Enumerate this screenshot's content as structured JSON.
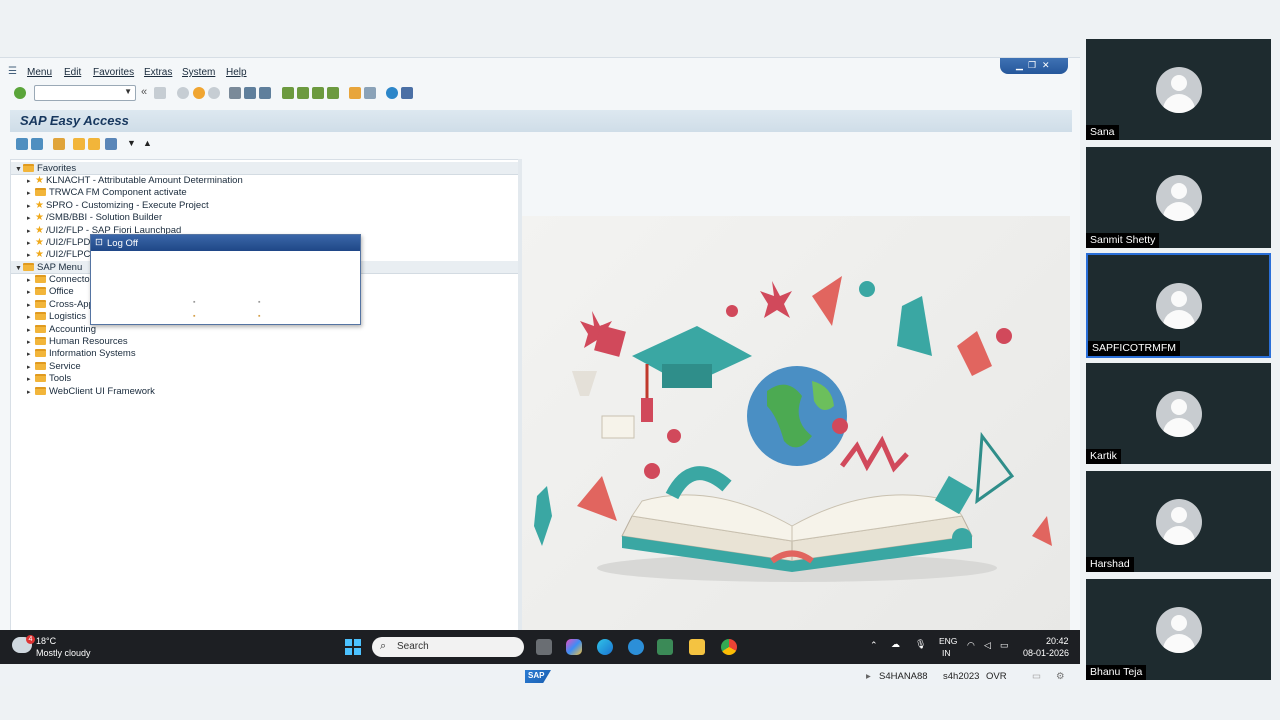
{
  "menu": {
    "items": [
      {
        "label": "Menu"
      },
      {
        "label": "Edit"
      },
      {
        "label": "Favorites"
      },
      {
        "label": "Extras"
      },
      {
        "label": "System"
      },
      {
        "label": "Help"
      }
    ]
  },
  "toolbar": {
    "command_value": "",
    "back_glyph": "«"
  },
  "screen_title": "SAP Easy Access",
  "tree": {
    "favorites_label": "Favorites",
    "favorites": [
      "KLNACHT - Attributable Amount Determination",
      "TRWCA FM Component activate",
      "SPRO - Customizing - Execute Project",
      "/SMB/BBI - Solution Builder",
      "/UI2/FLP - SAP Fiori Launchpad",
      "/UI2/FLPD",
      "/UI2/FLPC"
    ],
    "sap_menu_label": "SAP Menu",
    "sap_menu": [
      "Connector",
      "Office",
      "Cross-App",
      "Logistics",
      "Accounting",
      "Human Resources",
      "Information Systems",
      "Service",
      "Tools",
      "WebClient UI Framework"
    ]
  },
  "popup": {
    "title": "Log Off"
  },
  "status": {
    "system": "S4HANA88",
    "client": "s4h2023",
    "mode": "OVR",
    "logo": "SAP"
  },
  "taskbar": {
    "weather_temp": "18°C",
    "weather_desc": "Mostly cloudy",
    "weather_badge": "4",
    "search_placeholder": "Search",
    "lang_top": "ENG",
    "lang_bottom": "IN",
    "time": "20:42",
    "date": "08-01-2026"
  },
  "participants": [
    {
      "name": "Sana"
    },
    {
      "name": "Sanmit Shetty"
    },
    {
      "name": "SAPFICOTRMFM"
    },
    {
      "name": "Kartik"
    },
    {
      "name": "Harshad"
    },
    {
      "name": "Bhanu Teja"
    }
  ],
  "colors": {
    "accent": "#2a6fd8",
    "sap_title": "#17375e",
    "popup_header": "#1f4787",
    "tile_bg": "#1e2b2f"
  }
}
